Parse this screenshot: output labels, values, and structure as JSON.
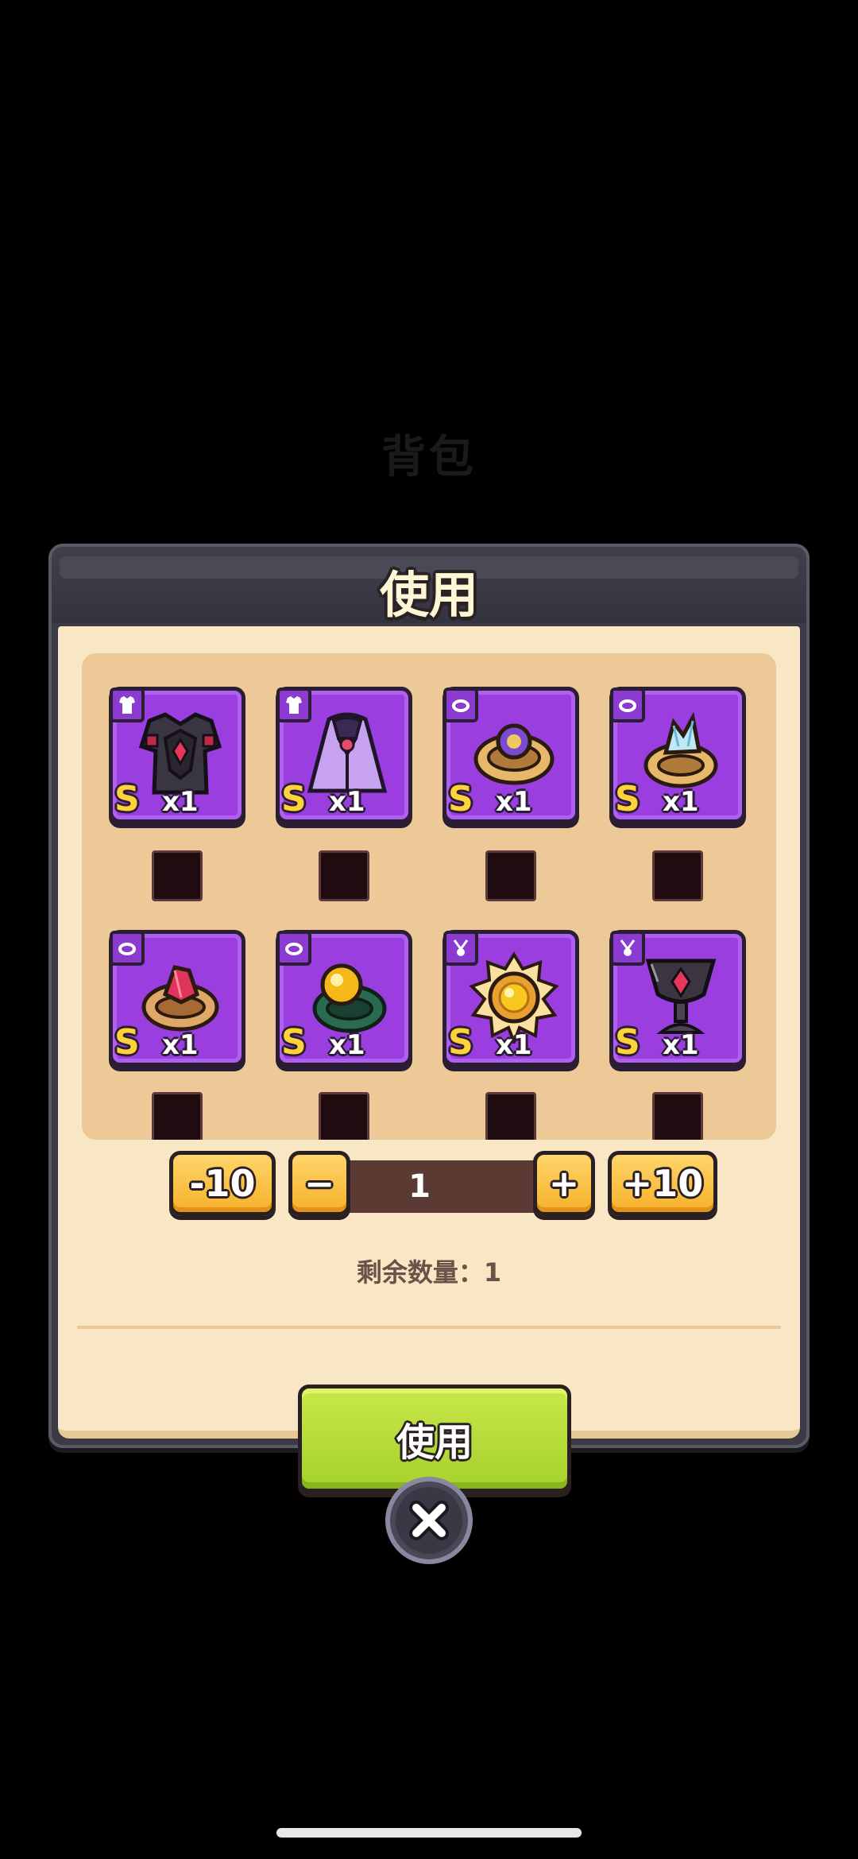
{
  "background": {
    "title": "背包"
  },
  "dialog": {
    "title": "使用"
  },
  "items": [
    {
      "type_icon": "armor-icon",
      "art": "dark-armor",
      "grade": "S",
      "count": "x1"
    },
    {
      "type_icon": "armor-icon",
      "art": "purple-cloak",
      "grade": "S",
      "count": "x1"
    },
    {
      "type_icon": "ring-icon",
      "art": "gold-ring-purple",
      "grade": "S",
      "count": "x1"
    },
    {
      "type_icon": "ring-icon",
      "art": "gold-ring-crystal",
      "grade": "S",
      "count": "x1"
    },
    {
      "type_icon": "ring-icon",
      "art": "gold-ring-red",
      "grade": "S",
      "count": "x1"
    },
    {
      "type_icon": "ring-icon",
      "art": "green-ring-amber",
      "grade": "S",
      "count": "x1"
    },
    {
      "type_icon": "necklace-icon",
      "art": "sun-medallion",
      "grade": "S",
      "count": "x1"
    },
    {
      "type_icon": "necklace-icon",
      "art": "dark-chalice-amulet",
      "grade": "S",
      "count": "x1"
    }
  ],
  "quantity": {
    "minus10_label": "-10",
    "minus_label": "−",
    "value": "1",
    "plus_label": "+",
    "plus10_label": "+10"
  },
  "remaining": {
    "text": "剩余数量：1"
  },
  "use_button": {
    "label": "使用"
  },
  "colors": {
    "tile_purple": "#9a3ee0",
    "grade_gold": "#ffd23a",
    "button_yellow": "#f6b12a",
    "use_green": "#a6d12c",
    "panel_cream": "#f8e6c5"
  }
}
